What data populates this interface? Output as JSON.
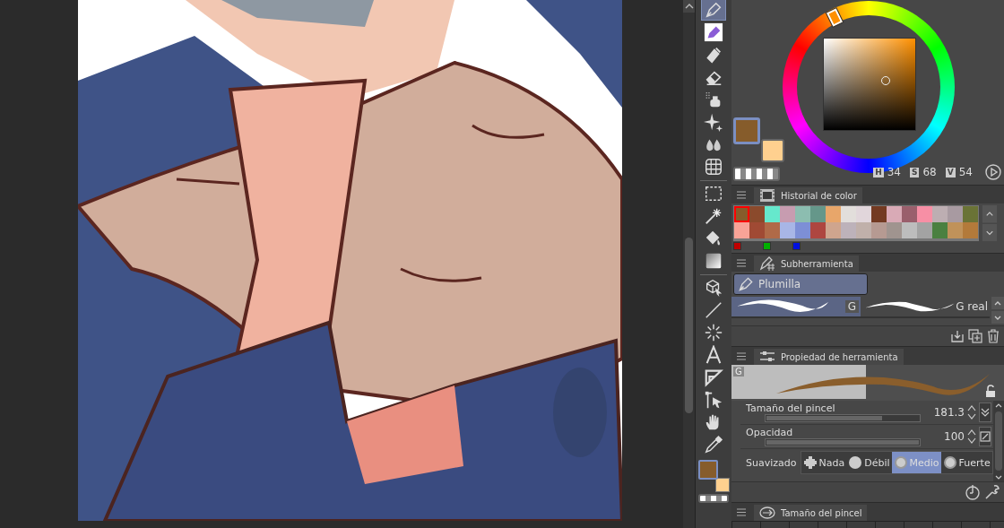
{
  "tools": [
    {
      "kind": "pen",
      "selected": true
    },
    {
      "kind": "marker",
      "selected": false
    },
    {
      "kind": "ink",
      "selected": false
    },
    {
      "kind": "eraser",
      "selected": false
    },
    {
      "kind": "airbrush",
      "selected": false
    },
    {
      "kind": "sparkle",
      "selected": false
    },
    {
      "kind": "blend",
      "selected": false
    },
    {
      "kind": "mesh",
      "selected": false
    },
    {
      "kind": "divider"
    },
    {
      "kind": "marquee",
      "selected": false
    },
    {
      "kind": "wand",
      "selected": false
    },
    {
      "kind": "fill",
      "selected": false
    },
    {
      "kind": "gradient",
      "selected": false
    },
    {
      "kind": "divider"
    },
    {
      "kind": "cube",
      "selected": false
    },
    {
      "kind": "line",
      "selected": false
    },
    {
      "kind": "burst",
      "selected": false
    },
    {
      "kind": "text",
      "selected": false
    },
    {
      "kind": "ruler",
      "selected": false
    },
    {
      "kind": "pointer",
      "selected": false
    },
    {
      "kind": "hand",
      "selected": false
    },
    {
      "kind": "dropper",
      "selected": false
    }
  ],
  "colors": [
    {
      "kind": "main",
      "color": "#865c2b"
    },
    {
      "kind": "sub",
      "color": "#ffd08f"
    }
  ],
  "hsv": [
    {
      "label": "H",
      "value": "34"
    },
    {
      "label": "S",
      "value": "68"
    },
    {
      "label": "V",
      "value": "54"
    }
  ],
  "color_history": {
    "title": "Historial de color",
    "swatches": [
      {
        "color": "#865c2b",
        "selected": true
      },
      {
        "color": "#8b4a2c",
        "selected": false
      },
      {
        "color": "#66e8cc",
        "selected": false
      },
      {
        "color": "#c79cb0",
        "selected": false
      },
      {
        "color": "#8cbdb0",
        "selected": false
      },
      {
        "color": "#65978a",
        "selected": false
      },
      {
        "color": "#e8a66a",
        "selected": false
      },
      {
        "color": "#e2dedb",
        "selected": false
      },
      {
        "color": "#e1d6db",
        "selected": false
      },
      {
        "color": "#733a22",
        "selected": false
      },
      {
        "color": "#d9aab6",
        "selected": false
      },
      {
        "color": "#9a5f6c",
        "selected": false
      },
      {
        "color": "#f78fa5",
        "selected": false
      },
      {
        "color": "#bdaeb2",
        "selected": false
      },
      {
        "color": "#a89aa1",
        "selected": false
      },
      {
        "color": "#6a7336",
        "selected": false
      },
      {
        "color": "#f8a397",
        "selected": false
      },
      {
        "color": "#a04a34",
        "selected": false
      },
      {
        "color": "#b06a48",
        "selected": false
      },
      {
        "color": "#a8b6e6",
        "selected": false
      },
      {
        "color": "#7d8fd6",
        "selected": false
      },
      {
        "color": "#ae4640",
        "selected": false
      },
      {
        "color": "#cfa58e",
        "selected": false
      },
      {
        "color": "#bdb2ba",
        "selected": false
      },
      {
        "color": "#c0b0aa",
        "selected": false
      },
      {
        "color": "#b69a92",
        "selected": false
      },
      {
        "color": "#a0948f",
        "selected": false
      },
      {
        "color": "#bdbdbd",
        "selected": false
      },
      {
        "color": "#a3a3a3",
        "selected": false
      },
      {
        "color": "#4a8040",
        "selected": false
      },
      {
        "color": "#c0925a",
        "selected": false
      },
      {
        "color": "#b37a3a",
        "selected": false
      }
    ],
    "markers": [
      {
        "color": "#c00000"
      },
      {
        "color": "#00b000"
      },
      {
        "color": "#0010e0"
      }
    ]
  },
  "subtool": {
    "title": "Subherramienta",
    "group": {
      "label": "Plumilla",
      "selected": true
    },
    "brushes": [
      {
        "label": "G",
        "selected": true
      },
      {
        "label": "G real",
        "selected": false
      }
    ]
  },
  "tool_property": {
    "title": "Propiedad de herramienta",
    "preview_label": "G",
    "properties": [
      {
        "label": "Tamaño del pincel",
        "value": "181.3",
        "level": 0.76
      },
      {
        "label": "Opacidad",
        "value": "100",
        "level": 1
      }
    ],
    "smoothing": {
      "label": "Suavizado",
      "options": [
        {
          "label": "Nada",
          "selected": false
        },
        {
          "label": "Débil",
          "selected": false
        },
        {
          "label": "Medio",
          "selected": true
        },
        {
          "label": "Fuerte",
          "selected": false
        }
      ]
    }
  },
  "brush_size_panel": {
    "title": "Tamaño del pincel"
  }
}
